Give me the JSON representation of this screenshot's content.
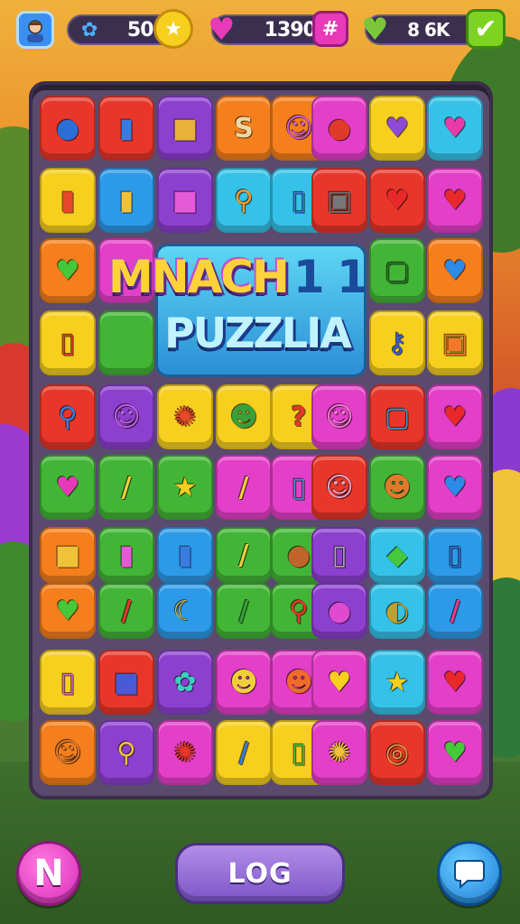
{
  "hud": {
    "avatar_icon": "player-avatar-icon",
    "level_value": "50",
    "level_icon": "ribbon-icon",
    "star_icon": "star-icon",
    "hearts_value": "1390",
    "hearts_icon": "heart-icon",
    "plus_icon": "hash-icon",
    "progress_value": "8 6K",
    "progress_icon": "green-heart-icon",
    "check_icon": "check-icon"
  },
  "logo": {
    "line1": "MNACH",
    "line1_tail": "1 1",
    "line2": "PUZZLIA"
  },
  "board": {
    "colors": {
      "red": "#e8372a",
      "orange": "#f57f1c",
      "yellow": "#f7cf1e",
      "green": "#43b536",
      "blue": "#2c9ae8",
      "purple": "#8d3fcf",
      "pink": "#e43fc9",
      "lightblue": "#35c2e8"
    },
    "tiles": [
      {
        "color": "red",
        "icon": "blob-icon",
        "glyph": "●",
        "glyph_color": "#2b6fd6"
      },
      {
        "color": "red",
        "icon": "battery-icon",
        "glyph": "▮",
        "glyph_color": "#3a7be0"
      },
      {
        "color": "purple",
        "icon": "box-icon",
        "glyph": "■",
        "glyph_color": "#e7b13a"
      },
      {
        "color": "orange",
        "icon": "snake-icon",
        "glyph": "S",
        "glyph_color": "#f0d8a0"
      },
      {
        "color": "orange",
        "icon": "monster-icon",
        "glyph": "☺",
        "glyph_color": "#d05ad6"
      },
      {
        "color": "pink",
        "icon": "fuzzy-icon",
        "glyph": "●",
        "glyph_color": "#e23a2a"
      },
      {
        "color": "yellow",
        "icon": "heart-icon",
        "glyph": "♥",
        "glyph_color": "#8c4ad6"
      },
      {
        "color": "lightblue",
        "icon": "heart-icon",
        "glyph": "♥",
        "glyph_color": "#e83aa8"
      },
      {
        "color": "yellow",
        "icon": "walkie-icon",
        "glyph": "▮",
        "glyph_color": "#e8472a"
      },
      {
        "color": "blue",
        "icon": "device-icon",
        "glyph": "▮",
        "glyph_color": "#f0c23a"
      },
      {
        "color": "purple",
        "icon": "bag-icon",
        "glyph": "■",
        "glyph_color": "#e55ad8"
      },
      {
        "color": "lightblue",
        "icon": "wand-icon",
        "glyph": "⚲",
        "glyph_color": "#f09a2a"
      },
      {
        "color": "lightblue",
        "icon": "phone-icon",
        "glyph": "▯",
        "glyph_color": "#3a7be0"
      },
      {
        "color": "red",
        "icon": "oven-icon",
        "glyph": "▣",
        "glyph_color": "#777777"
      },
      {
        "color": "red",
        "icon": "heart-icon",
        "glyph": "♥",
        "glyph_color": "#e8282a"
      },
      {
        "color": "pink",
        "icon": "heart-icon",
        "glyph": "♥",
        "glyph_color": "#e8282a"
      },
      {
        "color": "orange",
        "icon": "heart-icon",
        "glyph": "♥",
        "glyph_color": "#45c83a"
      },
      {
        "color": "pink",
        "icon": "blank-icon",
        "glyph": "",
        "glyph_color": "#ffffff"
      },
      {
        "color": "green",
        "icon": "frame-icon",
        "glyph": "▢",
        "glyph_color": "#2a7a2a"
      },
      {
        "color": "orange",
        "icon": "heart-icon",
        "glyph": "♥",
        "glyph_color": "#2c8ae8"
      },
      {
        "color": "yellow",
        "icon": "trash-icon",
        "glyph": "▯",
        "glyph_color": "#e8372a"
      },
      {
        "color": "green",
        "icon": "blank-icon",
        "glyph": "",
        "glyph_color": "#ffffff"
      },
      {
        "color": "yellow",
        "icon": "key-icon",
        "glyph": "⚷",
        "glyph_color": "#3a5ad6"
      },
      {
        "color": "yellow",
        "icon": "camera-icon",
        "glyph": "▣",
        "glyph_color": "#f07a2a"
      },
      {
        "color": "red",
        "icon": "wand-icon",
        "glyph": "⚲",
        "glyph_color": "#3a7be0"
      },
      {
        "color": "purple",
        "icon": "ghost-icon",
        "glyph": "☺",
        "glyph_color": "#c060e0"
      },
      {
        "color": "yellow",
        "icon": "gear-icon",
        "glyph": "✺",
        "glyph_color": "#e84a2a"
      },
      {
        "color": "yellow",
        "icon": "robot-icon",
        "glyph": "☻",
        "glyph_color": "#3aa03a"
      },
      {
        "color": "yellow",
        "icon": "question-icon",
        "glyph": "?",
        "glyph_color": "#e8372a"
      },
      {
        "color": "pink",
        "icon": "face-icon",
        "glyph": "☺",
        "glyph_color": "#f07ad0"
      },
      {
        "color": "red",
        "icon": "box-icon",
        "glyph": "▢",
        "glyph_color": "#3a9ad6"
      },
      {
        "color": "pink",
        "icon": "heart-icon",
        "glyph": "♥",
        "glyph_color": "#e8282a"
      },
      {
        "color": "green",
        "icon": "heart-icon",
        "glyph": "♥",
        "glyph_color": "#e83ab8"
      },
      {
        "color": "green",
        "icon": "pencil-icon",
        "glyph": "/",
        "glyph_color": "#f0d03a"
      },
      {
        "color": "green",
        "icon": "star-icon",
        "glyph": "★",
        "glyph_color": "#f7cf1e"
      },
      {
        "color": "pink",
        "icon": "brush-icon",
        "glyph": "/",
        "glyph_color": "#f0d03a"
      },
      {
        "color": "pink",
        "icon": "tube-icon",
        "glyph": "▯",
        "glyph_color": "#3a9ad6"
      },
      {
        "color": "red",
        "icon": "cat-icon",
        "glyph": "☺",
        "glyph_color": "#f0a0c0"
      },
      {
        "color": "green",
        "icon": "critter-icon",
        "glyph": "☻",
        "glyph_color": "#e07a2a"
      },
      {
        "color": "pink",
        "icon": "heart-icon",
        "glyph": "♥",
        "glyph_color": "#2c8ae8"
      },
      {
        "color": "orange",
        "icon": "box-icon",
        "glyph": "■",
        "glyph_color": "#f0c23a"
      },
      {
        "color": "green",
        "icon": "eraser-icon",
        "glyph": "▮",
        "glyph_color": "#e55ad8"
      },
      {
        "color": "blue",
        "icon": "cup-icon",
        "glyph": "▮",
        "glyph_color": "#3a7be0"
      },
      {
        "color": "green",
        "icon": "pencil-icon",
        "glyph": "/",
        "glyph_color": "#f0d03a"
      },
      {
        "color": "green",
        "icon": "rock-icon",
        "glyph": "●",
        "glyph_color": "#c0642a"
      },
      {
        "color": "purple",
        "icon": "phone-icon",
        "glyph": "▯",
        "glyph_color": "#aaaaaa"
      },
      {
        "color": "lightblue",
        "icon": "tag-icon",
        "glyph": "◆",
        "glyph_color": "#45c83a"
      },
      {
        "color": "blue",
        "icon": "phone-icon",
        "glyph": "▯",
        "glyph_color": "#3a6ad6"
      },
      {
        "color": "orange",
        "icon": "heart-icon",
        "glyph": "♥",
        "glyph_color": "#45c83a"
      },
      {
        "color": "green",
        "icon": "marker-icon",
        "glyph": "/",
        "glyph_color": "#e8372a"
      },
      {
        "color": "blue",
        "icon": "moon-icon",
        "glyph": "☾",
        "glyph_color": "#f0c23a"
      },
      {
        "color": "green",
        "icon": "pencil-icon",
        "glyph": "/",
        "glyph_color": "#3aa03a"
      },
      {
        "color": "green",
        "icon": "spoon-icon",
        "glyph": "⚲",
        "glyph_color": "#e8372a"
      },
      {
        "color": "purple",
        "icon": "berry-icon",
        "glyph": "●",
        "glyph_color": "#e04ad0"
      },
      {
        "color": "lightblue",
        "icon": "shell-icon",
        "glyph": "◐",
        "glyph_color": "#c0a030"
      },
      {
        "color": "blue",
        "icon": "marker-icon",
        "glyph": "/",
        "glyph_color": "#e83a8a"
      },
      {
        "color": "yellow",
        "icon": "sock-icon",
        "glyph": "▯",
        "glyph_color": "#e55ad8"
      },
      {
        "color": "red",
        "icon": "cube-icon",
        "glyph": "■",
        "glyph_color": "#4a5ad6"
      },
      {
        "color": "purple",
        "icon": "splat-icon",
        "glyph": "✿",
        "glyph_color": "#3ad0c0"
      },
      {
        "color": "pink",
        "icon": "duck-icon",
        "glyph": "☻",
        "glyph_color": "#f0d03a"
      },
      {
        "color": "pink",
        "icon": "fox-icon",
        "glyph": "☻",
        "glyph_color": "#f06a2a"
      },
      {
        "color": "pink",
        "icon": "heart-icon",
        "glyph": "♥",
        "glyph_color": "#f7cf1e"
      },
      {
        "color": "lightblue",
        "icon": "star-icon",
        "glyph": "★",
        "glyph_color": "#f7cf1e"
      },
      {
        "color": "pink",
        "icon": "heart-icon",
        "glyph": "♥",
        "glyph_color": "#e8282a"
      },
      {
        "color": "orange",
        "icon": "cat-icon",
        "glyph": "☺",
        "glyph_color": "#e07a2a"
      },
      {
        "color": "purple",
        "icon": "wand-icon",
        "glyph": "⚲",
        "glyph_color": "#f0c23a"
      },
      {
        "color": "pink",
        "icon": "gear-icon",
        "glyph": "✺",
        "glyph_color": "#e8372a"
      },
      {
        "color": "yellow",
        "icon": "pencil-icon",
        "glyph": "/",
        "glyph_color": "#3a7be0"
      },
      {
        "color": "yellow",
        "icon": "jar-icon",
        "glyph": "▯",
        "glyph_color": "#45c83a"
      },
      {
        "color": "pink",
        "icon": "sun-icon",
        "glyph": "✺",
        "glyph_color": "#f0c23a"
      },
      {
        "color": "red",
        "icon": "spiral-icon",
        "glyph": "◎",
        "glyph_color": "#e0a040"
      },
      {
        "color": "pink",
        "icon": "heart-icon",
        "glyph": "♥",
        "glyph_color": "#45c83a"
      }
    ]
  },
  "bottom": {
    "left_button_label": "N",
    "log_label": "LOG",
    "chat_icon": "chat-bubble-icon"
  }
}
